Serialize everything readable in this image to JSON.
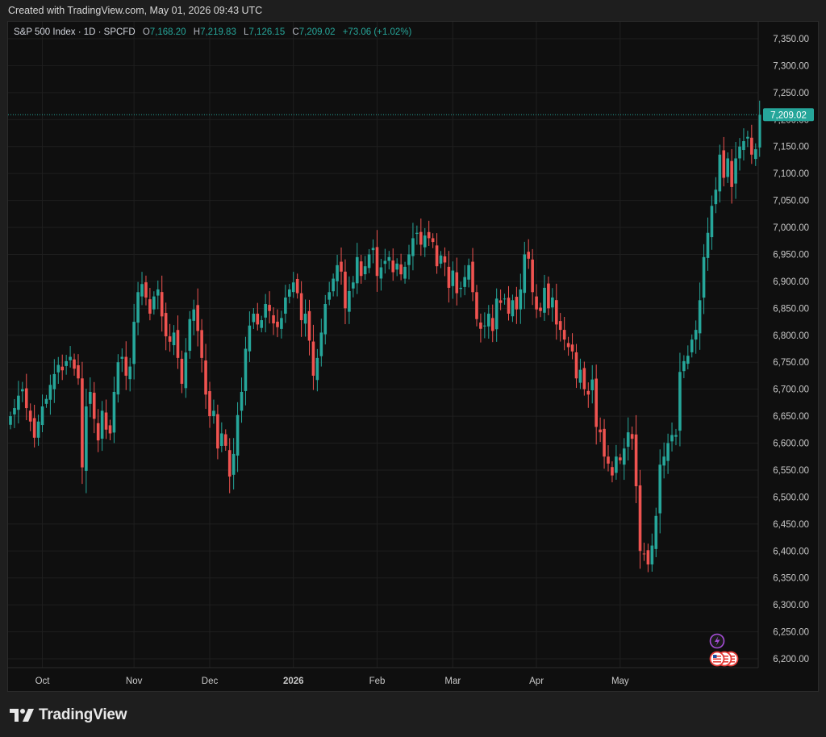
{
  "header": {
    "created_text": "Created with TradingView.com, May 01, 2026 09:43 UTC"
  },
  "legend": {
    "symbol": "S&P 500 Index · 1D · SPCFD",
    "o_label": "O",
    "o_value": "7,168.20",
    "h_label": "H",
    "h_value": "7,219.83",
    "l_label": "L",
    "l_value": "7,126.15",
    "c_label": "C",
    "c_value": "7,209.02",
    "change": "+73.06 (+1.02%)"
  },
  "footer": {
    "brand": "TradingView"
  },
  "colors": {
    "up": "#26a69a",
    "down": "#ef5350",
    "grid": "#1f1f1f",
    "price_tag": "#26a69a",
    "background": "#0f0f0f"
  },
  "icons": [
    "lightning-icon",
    "us-flag-icon"
  ],
  "chart_data": {
    "type": "candlestick",
    "last_price_label": "7,209.02",
    "ylim": [
      6165,
      7380
    ],
    "y_ticks": [
      6200,
      6250,
      6300,
      6350,
      6400,
      6450,
      6500,
      6550,
      6600,
      6650,
      6700,
      6750,
      6800,
      6850,
      6900,
      6950,
      7000,
      7050,
      7100,
      7150,
      7200,
      7250,
      7300,
      7350
    ],
    "y_tick_labels": [
      "6,200.00",
      "6,250.00",
      "6,300.00",
      "6,350.00",
      "6,400.00",
      "6,450.00",
      "6,500.00",
      "6,550.00",
      "6,600.00",
      "6,650.00",
      "6,700.00",
      "6,750.00",
      "6,800.00",
      "6,850.00",
      "6,900.00",
      "6,950.00",
      "7,000.00",
      "7,050.00",
      "7,100.00",
      "7,150.00",
      "7,200.00",
      "7,250.00",
      "7,300.00",
      "7,350.00"
    ],
    "x_labels": [
      {
        "label": "Oct",
        "index": 8,
        "bold": false
      },
      {
        "label": "Nov",
        "index": 31,
        "bold": false
      },
      {
        "label": "Dec",
        "index": 50,
        "bold": false
      },
      {
        "label": "2026",
        "index": 71,
        "bold": true
      },
      {
        "label": "Feb",
        "index": 92,
        "bold": false
      },
      {
        "label": "Mar",
        "index": 111,
        "bold": false
      },
      {
        "label": "Apr",
        "index": 132,
        "bold": false
      },
      {
        "label": "May",
        "index": 153,
        "bold": false
      }
    ],
    "closes": [
      6650,
      6665,
      6688,
      6700,
      6665,
      6640,
      6610,
      6640,
      6668,
      6682,
      6708,
      6728,
      6745,
      6735,
      6752,
      6760,
      6738,
      6720,
      6555,
      6668,
      6695,
      6645,
      6605,
      6660,
      6625,
      6618,
      6695,
      6750,
      6760,
      6725,
      6742,
      6825,
      6880,
      6895,
      6870,
      6840,
      6872,
      6885,
      6835,
      6798,
      6788,
      6805,
      6758,
      6710,
      6768,
      6830,
      6848,
      6808,
      6758,
      6690,
      6650,
      6660,
      6590,
      6618,
      6595,
      6538,
      6580,
      6652,
      6695,
      6775,
      6818,
      6840,
      6820,
      6828,
      6858,
      6845,
      6822,
      6815,
      6832,
      6870,
      6885,
      6898,
      6878,
      6828,
      6840,
      6790,
      6725,
      6758,
      6805,
      6858,
      6880,
      6905,
      6930,
      6918,
      6850,
      6882,
      6898,
      6945,
      6910,
      6928,
      6950,
      6962,
      6910,
      6926,
      6938,
      6945,
      6917,
      6933,
      6913,
      6927,
      6950,
      6980,
      6990,
      6968,
      6985,
      6980,
      6973,
      6928,
      6948,
      6935,
      6888,
      6920,
      6878,
      6888,
      6908,
      6930,
      6880,
      6830,
      6812,
      6818,
      6840,
      6808,
      6868,
      6860,
      6868,
      6840,
      6865,
      6848,
      6885,
      6950,
      6942,
      6880,
      6848,
      6845,
      6888,
      6850,
      6870,
      6820,
      6810,
      6792,
      6778,
      6770,
      6720,
      6736,
      6700,
      6690,
      6718,
      6630,
      6620,
      6575,
      6562,
      6540,
      6575,
      6568,
      6590,
      6620,
      6608,
      6520,
      6400,
      6395,
      6375,
      6410,
      6465,
      6560,
      6575,
      6600,
      6615,
      6615,
      6732,
      6752,
      6762,
      6792,
      6810,
      6865,
      6945,
      6990,
      7040,
      7070,
      7135,
      7092,
      7128,
      7075,
      7128,
      7150,
      7160,
      7168,
      7135,
      7145,
      7209
    ]
  }
}
